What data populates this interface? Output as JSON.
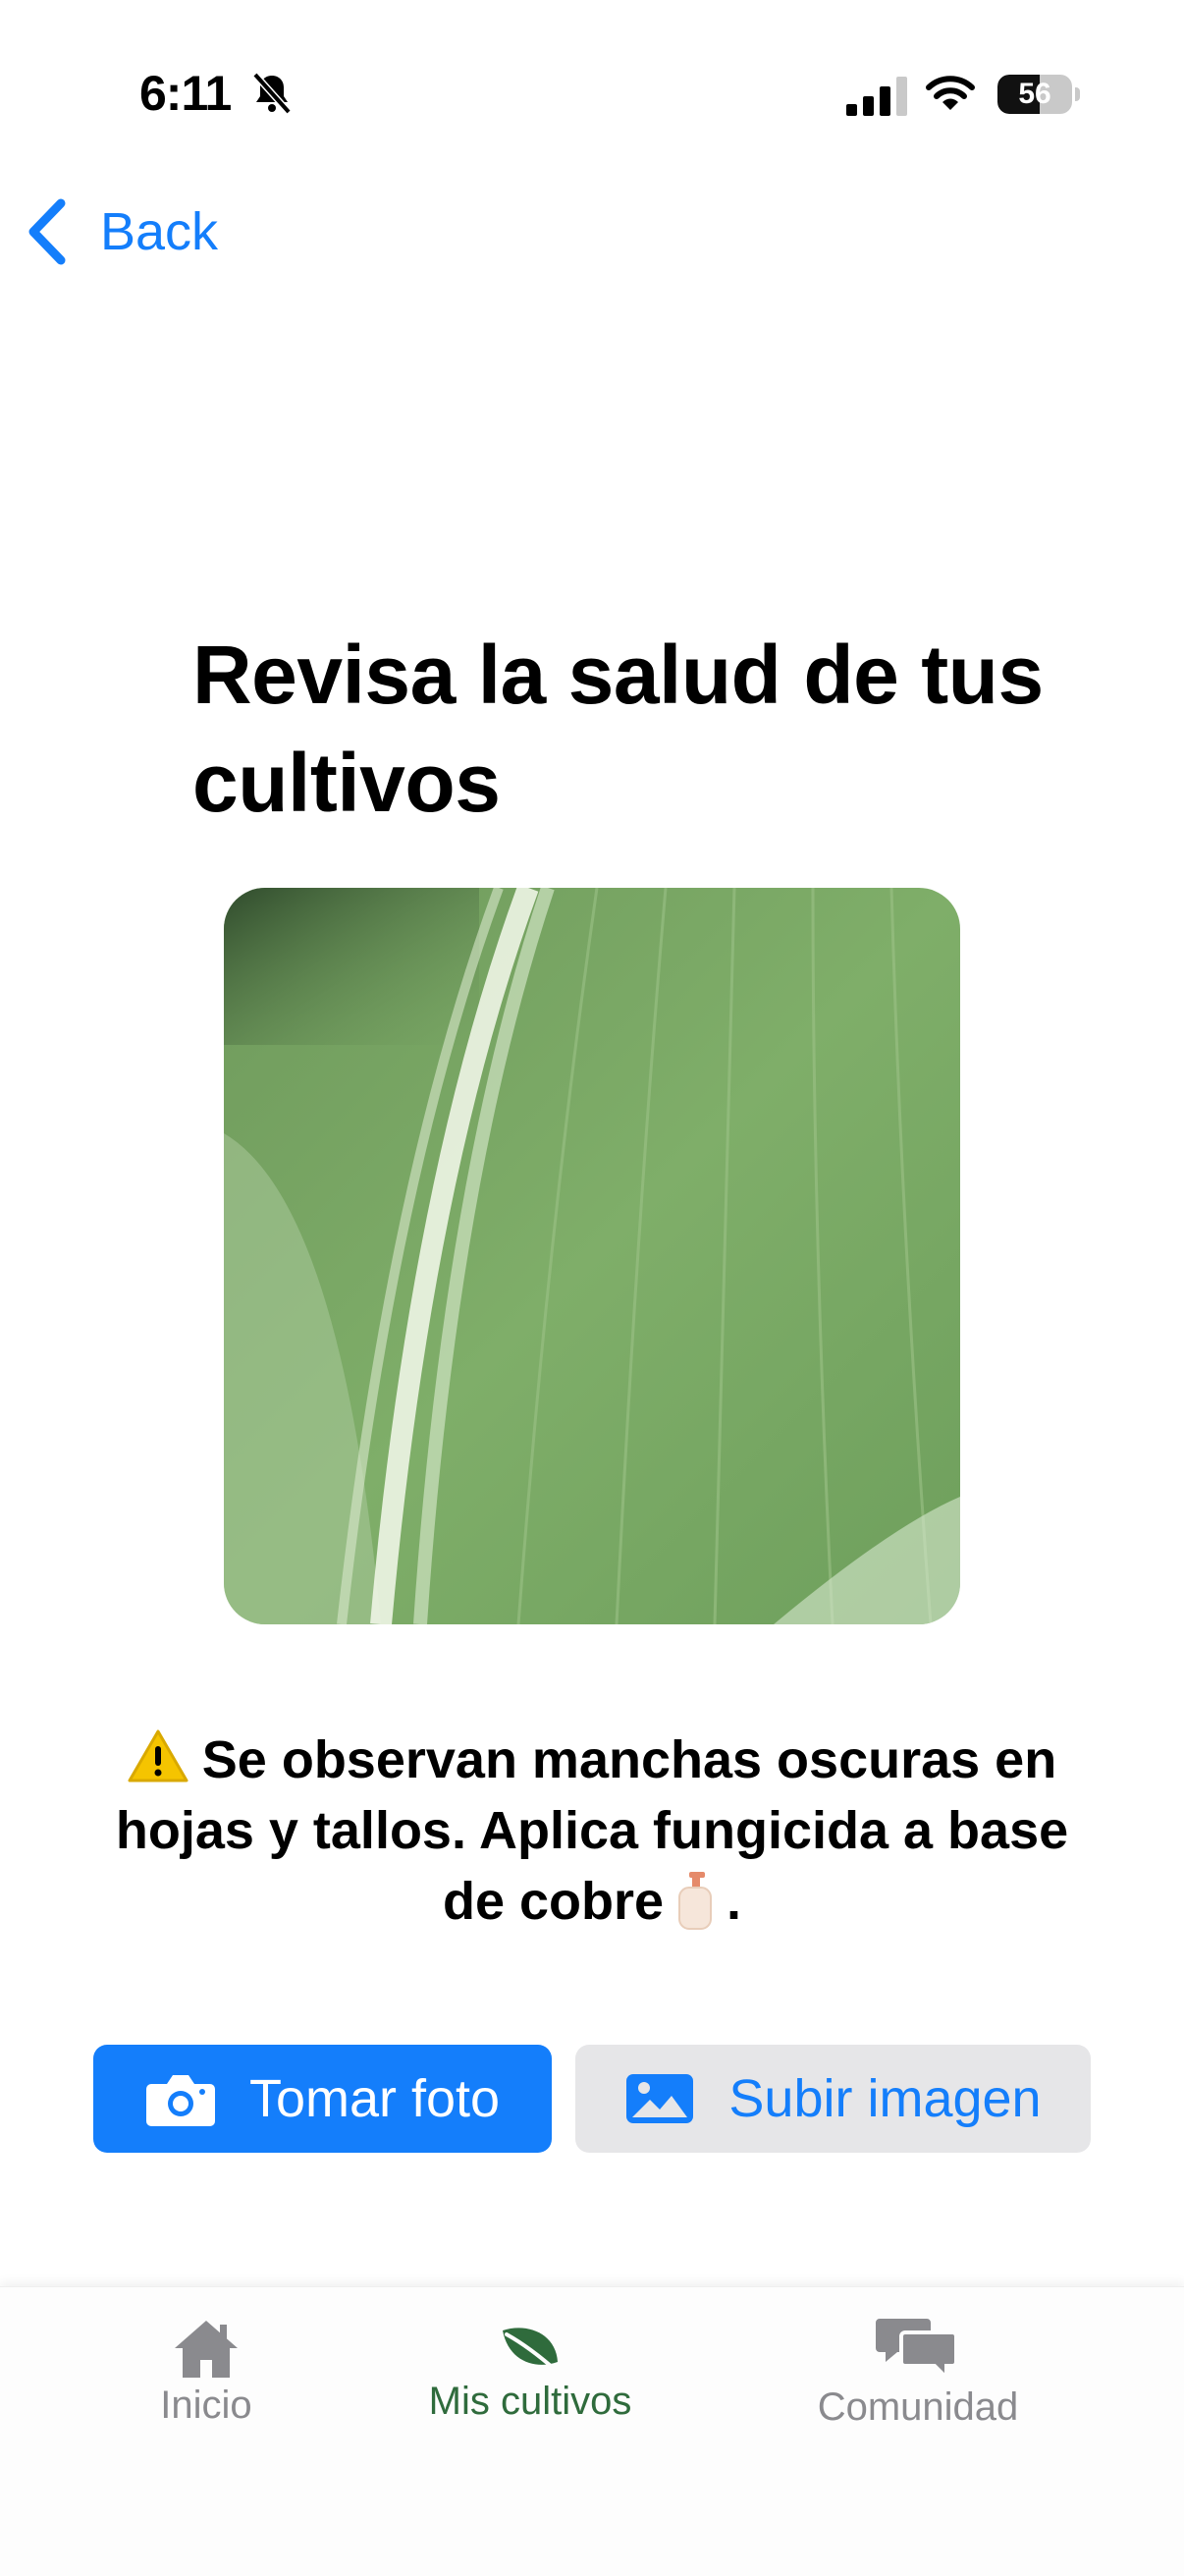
{
  "status_bar": {
    "time": "6:11",
    "battery_level": "56",
    "battery_fraction": 0.56
  },
  "nav": {
    "back_label": "Back"
  },
  "page": {
    "title": "Revisa la salud de tus cultivos",
    "diagnosis_text": "Se observan manchas oscuras en hojas y tallos. Aplica fungicida a base de cobre",
    "diagnosis_end": "."
  },
  "actions": {
    "take_photo_label": "Tomar foto",
    "upload_image_label": "Subir imagen"
  },
  "tab_bar": {
    "items": [
      {
        "label": "Inicio",
        "icon": "home-icon",
        "active": false
      },
      {
        "label": "Mis cultivos",
        "icon": "leaf-icon",
        "active": true
      },
      {
        "label": "Comunidad",
        "icon": "chat-bubbles-icon",
        "active": false
      }
    ]
  },
  "colors": {
    "accent": "#147efb",
    "active_tab": "#2f6b3c",
    "inactive_tab": "#8a8a8e",
    "secondary_button_bg": "#e6e6e8"
  }
}
